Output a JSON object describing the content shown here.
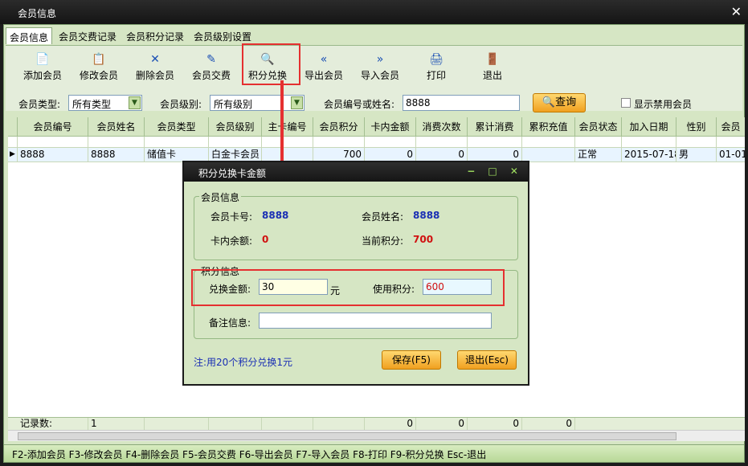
{
  "window": {
    "title": "会员信息",
    "close_label": "✕"
  },
  "tabs": [
    "会员信息",
    "会员交费记录",
    "会员积分记录",
    "会员级别设置"
  ],
  "toolbar": {
    "buttons": [
      {
        "label": "添加会员",
        "icon": "📄"
      },
      {
        "label": "修改会员",
        "icon": "📋"
      },
      {
        "label": "删除会员",
        "icon": "✕"
      },
      {
        "label": "会员交费",
        "icon": "✎"
      },
      {
        "label": "积分兑换",
        "icon": "🔍"
      },
      {
        "label": "导出会员",
        "icon": "«"
      },
      {
        "label": "导入会员",
        "icon": "»"
      },
      {
        "label": "打印",
        "icon": "🖨"
      },
      {
        "label": "退出",
        "icon": "🚪"
      }
    ]
  },
  "filters": {
    "type_label": "会员类型:",
    "type_value": "所有类型",
    "level_label": "会员级别:",
    "level_value": "所有级别",
    "search_label": "会员编号或姓名:",
    "search_value": "8888",
    "query_label": "查询",
    "show_disabled_label": "显示禁用会员"
  },
  "grid": {
    "columns": [
      "会员编号",
      "会员姓名",
      "会员类型",
      "会员级别",
      "主卡编号",
      "会员积分",
      "卡内金额",
      "消费次数",
      "累计消费",
      "累积充值",
      "会员状态",
      "加入日期",
      "性别",
      "会员"
    ],
    "rows": [
      [
        "8888",
        "8888",
        "储值卡",
        "白金卡会员",
        "",
        "700",
        "0",
        "0",
        "0",
        "",
        "正常",
        "2015-07-18",
        "男",
        "01-01"
      ]
    ],
    "summary": {
      "label": "记录数:",
      "count": "1",
      "v1": "0",
      "v2": "0",
      "v3": "0",
      "v4": "0"
    }
  },
  "statusbar": "F2-添加会员 F3-修改会员 F4-删除会员 F5-会员交费 F6-导出会员 F7-导入会员 F8-打印 F9-积分兑换 Esc-退出",
  "dialog": {
    "title": "积分兑换卡金额",
    "controls": "−  □  ✕",
    "member_group": "会员信息",
    "card_no_label": "会员卡号:",
    "card_no": "8888",
    "name_label": "会员姓名:",
    "name": "8888",
    "balance_label": "卡内余额:",
    "balance": "0",
    "points_label": "当前积分:",
    "points": "700",
    "points_group": "积分信息",
    "amount_label": "兑换金额:",
    "amount": "30",
    "amount_unit": "元",
    "use_points_label": "使用积分:",
    "use_points": "600",
    "note_label": "备注信息:",
    "note": "",
    "hint": "注:用20个积分兑换1元",
    "save_label": "保存(F5)",
    "exit_label": "退出(Esc)"
  }
}
